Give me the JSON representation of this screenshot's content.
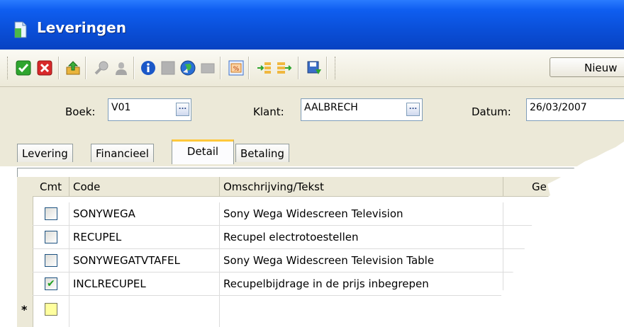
{
  "window": {
    "title": "Leveringen"
  },
  "toolbar": {
    "new_label": "Nieuw",
    "buttons": [
      "confirm-icon",
      "cancel-icon",
      "export-icon",
      "search-icon",
      "user-icon",
      "info-icon",
      "square-icon",
      "globe-icon",
      "rect-icon",
      "percent-icon",
      "insert-row-icon",
      "append-row-icon",
      "save-icon"
    ]
  },
  "header": {
    "boek_label": "Boek:",
    "boek_value": "V01",
    "klant_label": "Klant:",
    "klant_value": "AALBRECH",
    "datum_label": "Datum:",
    "datum_value": "26/03/2007",
    "ellipsis": "..."
  },
  "tabs": [
    {
      "label": "Levering",
      "active": false
    },
    {
      "label": "Financieel",
      "active": false
    },
    {
      "label": "Detail",
      "active": true
    },
    {
      "label": "Betaling",
      "active": false
    }
  ],
  "grid": {
    "columns": [
      "Cmt",
      "Code",
      "Omschrijving/Tekst",
      "Ge"
    ],
    "rows": [
      {
        "checked": false,
        "code": "SONYWEGA",
        "desc": "Sony Wega Widescreen Television"
      },
      {
        "checked": false,
        "code": "RECUPEL",
        "desc": "Recupel electrotoestellen"
      },
      {
        "checked": false,
        "code": "SONYWEGATVTAFEL",
        "desc": "Sony Wega Widescreen Television Table"
      },
      {
        "checked": true,
        "code": "INCLRECUPEL",
        "desc": "Recupelbijdrage in de prijs inbegrepen"
      }
    ],
    "new_row_marker": "*"
  }
}
